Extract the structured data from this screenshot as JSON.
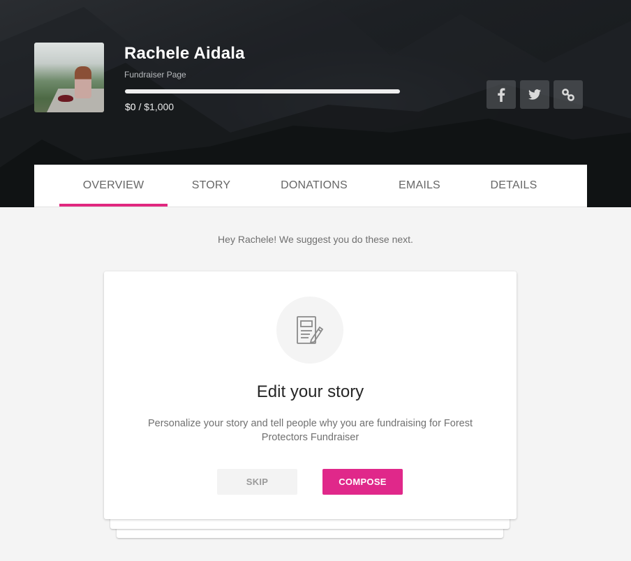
{
  "header": {
    "name": "Rachele Aidala",
    "subtitle": "Fundraiser Page",
    "raised": "$0",
    "separator": " / ",
    "goal": "$1,000",
    "progress_fraction": 0,
    "accent_color": "#e0287f"
  },
  "share": [
    {
      "icon": "facebook-icon",
      "label": "Share on Facebook"
    },
    {
      "icon": "twitter-icon",
      "label": "Share on Twitter"
    },
    {
      "icon": "link-icon",
      "label": "Copy link"
    }
  ],
  "tabs": [
    {
      "label": "OVERVIEW",
      "active": true
    },
    {
      "label": "STORY",
      "active": false
    },
    {
      "label": "DONATIONS",
      "active": false
    },
    {
      "label": "EMAILS",
      "active": false
    },
    {
      "label": "DETAILS",
      "active": false
    }
  ],
  "main": {
    "suggestion": "Hey Rachele! We suggest you do these next.",
    "card": {
      "icon": "edit-document-icon",
      "title": "Edit your story",
      "description": "Personalize your story and tell people why you are fundraising for Forest Protectors Fundraiser",
      "skip_label": "SKIP",
      "compose_label": "COMPOSE",
      "compose_color": "#e0288a"
    }
  }
}
